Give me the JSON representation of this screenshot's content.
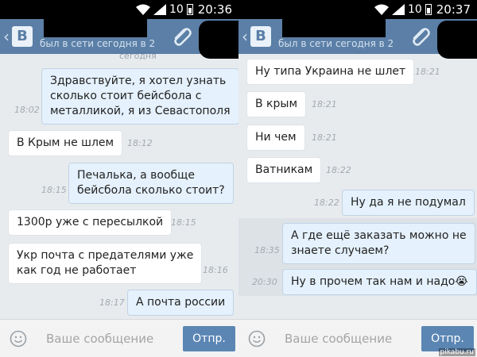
{
  "left": {
    "status": {
      "num": "10",
      "time": "20:36"
    },
    "header": {
      "status": "был в сети сегодня в 2"
    },
    "clipped_text": "сегодня",
    "messages": [
      {
        "dir": "out",
        "text": "Здравствуйте, я хотел узнать\nсколько стоит бейсбола с\nметалликой, я из Севастополя",
        "time": "18:02"
      },
      {
        "dir": "in",
        "text": "В Крым не шлем",
        "time": "18:12"
      },
      {
        "dir": "out",
        "text": "Печалька, а вообще\nбейсбола сколько стоит?",
        "time": "18:15"
      },
      {
        "dir": "in",
        "text": "1300р уже с пересылкой",
        "time": "18:15"
      },
      {
        "dir": "in",
        "text": "Укр почта с предателями уже\nкак год не работает",
        "time": "18:16"
      },
      {
        "dir": "out",
        "text": "А почта россии",
        "time": "18:17"
      }
    ],
    "compose": {
      "placeholder": "Ваше сообщение",
      "send": "Отпр."
    }
  },
  "right": {
    "status": {
      "num": "10",
      "time": "20:37"
    },
    "header": {
      "status": "был в сети сегодня в 2"
    },
    "messages": [
      {
        "dir": "in",
        "text": "Ну типа Украина не шлет",
        "time": "18:21"
      },
      {
        "dir": "in",
        "text": "В крым",
        "time": "18:21"
      },
      {
        "dir": "in",
        "text": "Ни чем",
        "time": "18:21"
      },
      {
        "dir": "in",
        "text": "Ватникам",
        "time": "18:22"
      },
      {
        "dir": "out",
        "text": "Ну да я не подумал",
        "time": "18:22"
      },
      {
        "dir": "out",
        "text": "А где ещё заказать можно не\nзнаете случаем?",
        "time": "18:35"
      },
      {
        "dir": "out",
        "text": "Ну в прочем так нам и надо😭",
        "time": "20:30"
      }
    ],
    "compose": {
      "placeholder": "Ваше сообщение",
      "send": "Отпр."
    },
    "watermark": "pikabu.ru"
  },
  "colors": {
    "header": "#5b7fa6",
    "out_bubble": "#e5f1fc",
    "in_bubble": "#ffffff",
    "send": "#5b86b4",
    "chat_bg": "#e8ebee"
  }
}
